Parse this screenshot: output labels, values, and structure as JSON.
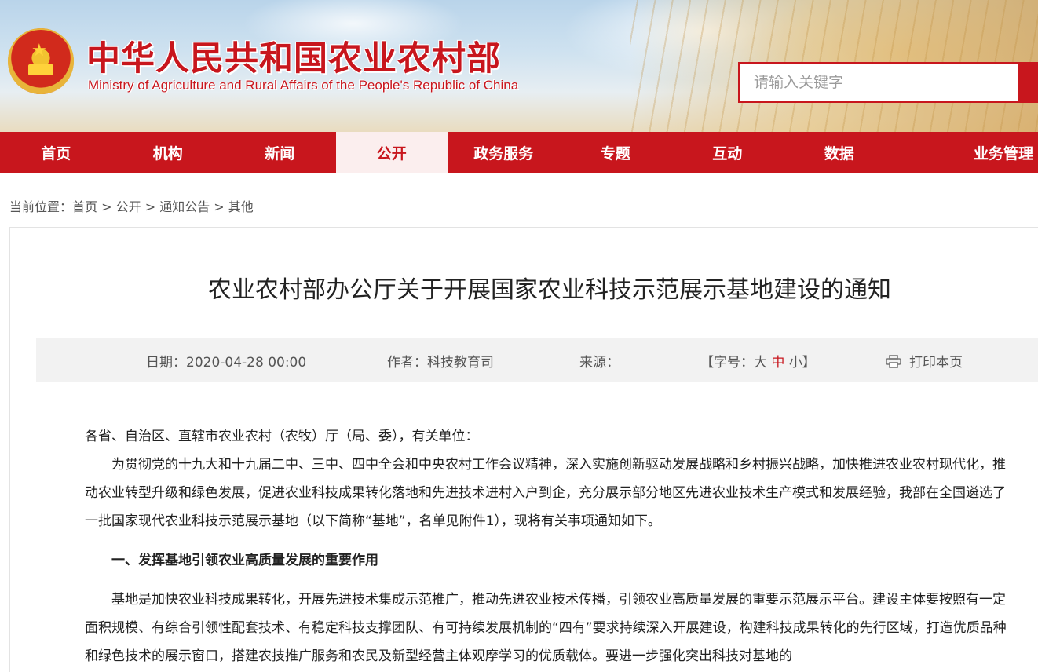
{
  "header": {
    "title": "中华人民共和国农业农村部",
    "subtitle": "Ministry of Agriculture and Rural Affairs of the People's Republic of China",
    "emblem_icon": "national-emblem-icon",
    "search_placeholder": "请输入关键字",
    "brand_color": "#c8161d"
  },
  "nav": {
    "items": [
      {
        "label": "首页"
      },
      {
        "label": "机构"
      },
      {
        "label": "新闻"
      },
      {
        "label": "公开",
        "active": true
      },
      {
        "label": "政务服务"
      },
      {
        "label": "专题"
      },
      {
        "label": "互动"
      },
      {
        "label": "数据"
      },
      {
        "label": "业务管理"
      }
    ]
  },
  "breadcrumb": {
    "prefix": "当前位置：",
    "items": [
      "首页",
      "公开",
      "通知公告",
      "其他"
    ],
    "separator": " > "
  },
  "article": {
    "title": "农业农村部办公厅关于开展国家农业科技示范展示基地建设的通知",
    "meta": {
      "date": "日期：2020-04-28 00:00",
      "author": "作者：科技教育司",
      "source": "来源：",
      "font_prefix": "【字号：",
      "font_large": "大",
      "font_medium": "中",
      "font_small": "小",
      "font_suffix": "】",
      "print": "打印本页"
    },
    "salutation": "各省、自治区、直辖市农业农村（农牧）厅（局、委），有关单位：",
    "para1": "为贯彻党的十九大和十九届二中、三中、四中全会和中央农村工作会议精神，深入实施创新驱动发展战略和乡村振兴战略，加快推进农业农村现代化，推动农业转型升级和绿色发展，促进农业科技成果转化落地和先进技术进村入户到企，充分展示部分地区先进农业技术生产模式和发展经验，我部在全国遴选了一批国家现代农业科技示范展示基地（以下简称“基地”，名单见附件1），现将有关事项通知如下。",
    "section1": "一、发挥基地引领农业高质量发展的重要作用",
    "para2": "基地是加快农业科技成果转化，开展先进技术集成示范推广，推动先进农业技术传播，引领农业高质量发展的重要示范展示平台。建设主体要按照有一定面积规模、有综合引领性配套技术、有稳定科技支撑团队、有可持续发展机制的“四有”要求持续深入开展建设，构建科技成果转化的先行区域，打造优质品种和绿色技术的展示窗口，搭建农技推广服务和农民及新型经营主体观摩学习的优质载体。要进一步强化突出科技对基地的"
  }
}
